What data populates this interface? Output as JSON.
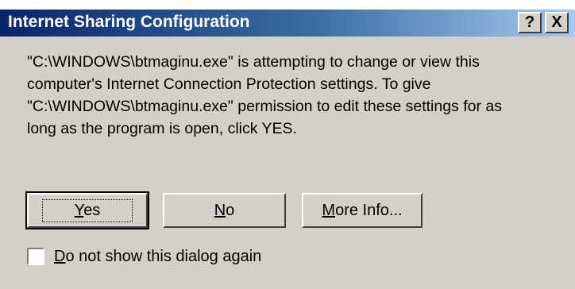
{
  "window": {
    "title": "Internet Sharing Configuration",
    "help_label": "?",
    "close_label": "X"
  },
  "message": {
    "lines": [
      "\"C:\\WINDOWS\\btmaginu.exe\" is attempting to change or view this",
      "computer's Internet Connection Protection settings. To give",
      "\"C:\\WINDOWS\\btmaginu.exe\" permission to edit these settings for as",
      "long as the program is open, click YES."
    ]
  },
  "buttons": {
    "yes": {
      "mnemonic": "Y",
      "rest": "es"
    },
    "no": {
      "mnemonic": "N",
      "rest": "o"
    },
    "more_info": {
      "mnemonic": "M",
      "rest": "ore Info..."
    }
  },
  "checkbox": {
    "checked": false,
    "label_mnemonic": "D",
    "label_rest": "o not show this dialog again"
  },
  "colors": {
    "titlebar_start": "#0a246a",
    "titlebar_end": "#a6caf0",
    "dialog_face": "#d4d0c8"
  }
}
